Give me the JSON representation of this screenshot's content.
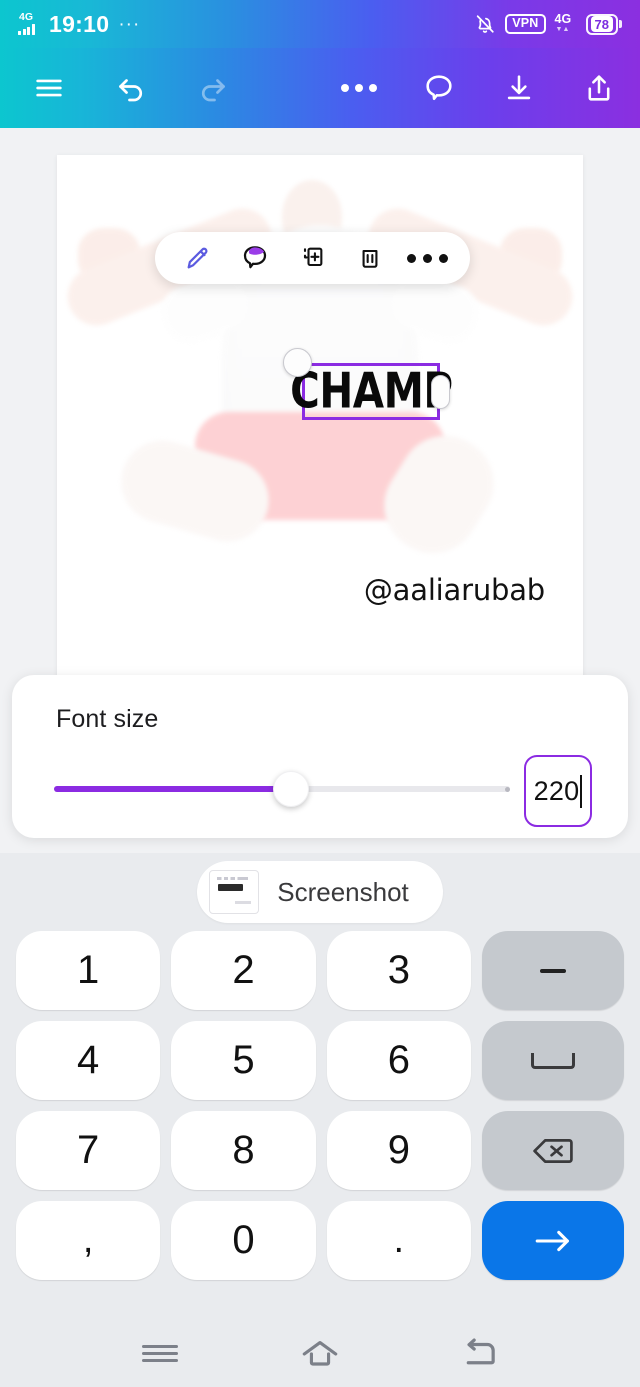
{
  "statusbar": {
    "time": "19:10",
    "dots": "···",
    "network_left": "4G",
    "network_right": "4G",
    "vpn": "VPN",
    "battery": "78",
    "icons": [
      "signal-4g-icon",
      "overflow-dots-icon",
      "mute-bell-icon",
      "vpn-badge",
      "signal-4g-icon",
      "battery-icon"
    ]
  },
  "toolbar": {
    "menu": "hamburger-menu-icon",
    "undo": "undo-icon",
    "redo": "redo-icon",
    "more": "more-options-icon",
    "comment": "comment-bubble-icon",
    "download": "download-icon",
    "share": "share-icon"
  },
  "object_menu": {
    "items": [
      "edit-pen-icon",
      "comment-bubble-icon",
      "duplicate-icon",
      "delete-trash-icon",
      "more-options-icon"
    ]
  },
  "canvas": {
    "text_object": "CHAMP",
    "watermark": "@aaliarubab",
    "selection_color": "#8b2be2",
    "handles": [
      "rotate-handle",
      "resize-handle"
    ]
  },
  "panel": {
    "label": "Font size",
    "value": "220",
    "slider_percent": 52,
    "accent_color": "#8b2be2"
  },
  "keyboard": {
    "suggestion": "Screenshot",
    "rows": [
      [
        {
          "label": "1",
          "name": "key-1",
          "type": "num"
        },
        {
          "label": "2",
          "name": "key-2",
          "type": "num"
        },
        {
          "label": "3",
          "name": "key-3",
          "type": "num"
        },
        {
          "label": "−",
          "name": "key-minus",
          "type": "fn-dash"
        }
      ],
      [
        {
          "label": "4",
          "name": "key-4",
          "type": "num"
        },
        {
          "label": "5",
          "name": "key-5",
          "type": "num"
        },
        {
          "label": "6",
          "name": "key-6",
          "type": "num"
        },
        {
          "label": "␣",
          "name": "key-space",
          "type": "fn-space"
        }
      ],
      [
        {
          "label": "7",
          "name": "key-7",
          "type": "num"
        },
        {
          "label": "8",
          "name": "key-8",
          "type": "num"
        },
        {
          "label": "9",
          "name": "key-9",
          "type": "num"
        },
        {
          "label": "⌫",
          "name": "key-backspace",
          "type": "fn-backspace"
        }
      ],
      [
        {
          "label": ",",
          "name": "key-comma",
          "type": "num"
        },
        {
          "label": "0",
          "name": "key-0",
          "type": "num"
        },
        {
          "label": ".",
          "name": "key-period",
          "type": "num"
        },
        {
          "label": "→",
          "name": "key-enter",
          "type": "enter"
        }
      ]
    ]
  },
  "navbar": {
    "recents": "recents-icon",
    "home": "home-icon",
    "back": "back-icon"
  }
}
